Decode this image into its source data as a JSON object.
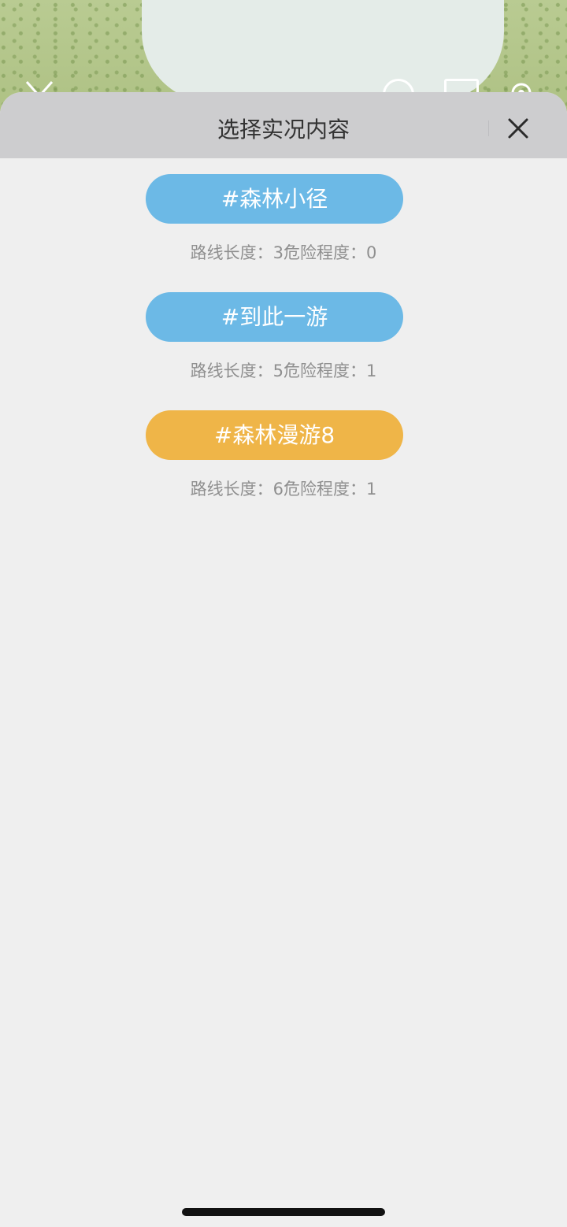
{
  "sheet": {
    "title": "选择实况内容"
  },
  "routes": [
    {
      "name": "#森林小径",
      "color": "#6cb9e6",
      "length_label": "路线长度：",
      "length_value": "3",
      "danger_label": "危险程度：",
      "danger_value": "0"
    },
    {
      "name": "#到此一游",
      "color": "#6cb9e6",
      "length_label": "路线长度：",
      "length_value": "5",
      "danger_label": "危险程度：",
      "danger_value": "1"
    },
    {
      "name": "#森林漫游8",
      "color": "#efb548",
      "length_label": "路线长度：",
      "length_value": "6",
      "danger_label": "危险程度：",
      "danger_value": "1"
    }
  ],
  "colors": {
    "sheet_background": "#efefef",
    "header_background": "#cdcdcf",
    "route_blue": "#6cb9e6",
    "route_orange": "#efb548",
    "meta_text": "#8f8f8f"
  },
  "icons": {
    "close": "close-icon",
    "back": "back-icon",
    "camera": "camera-icon",
    "gallery": "gallery-icon",
    "settings": "gear-icon"
  }
}
